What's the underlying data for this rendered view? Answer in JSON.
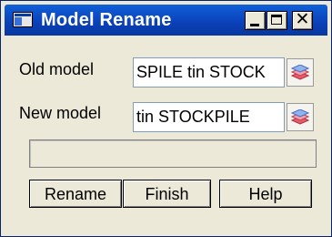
{
  "window": {
    "title": "Model Rename",
    "title_bar_color": "#0a40b8"
  },
  "form": {
    "old_model": {
      "label": "Old model",
      "value": "SPILE tin STOCK"
    },
    "new_model": {
      "label": "New model",
      "value": "tin STOCKPILE"
    }
  },
  "progress": {
    "value": 0
  },
  "buttons": {
    "rename": "Rename",
    "finish": "Finish",
    "help": "Help"
  },
  "icons": {
    "app": "window-app-icon",
    "minimize": "minimize-icon",
    "maximize": "maximize-icon",
    "close": "close-icon",
    "model_picker": "layers-icon"
  }
}
